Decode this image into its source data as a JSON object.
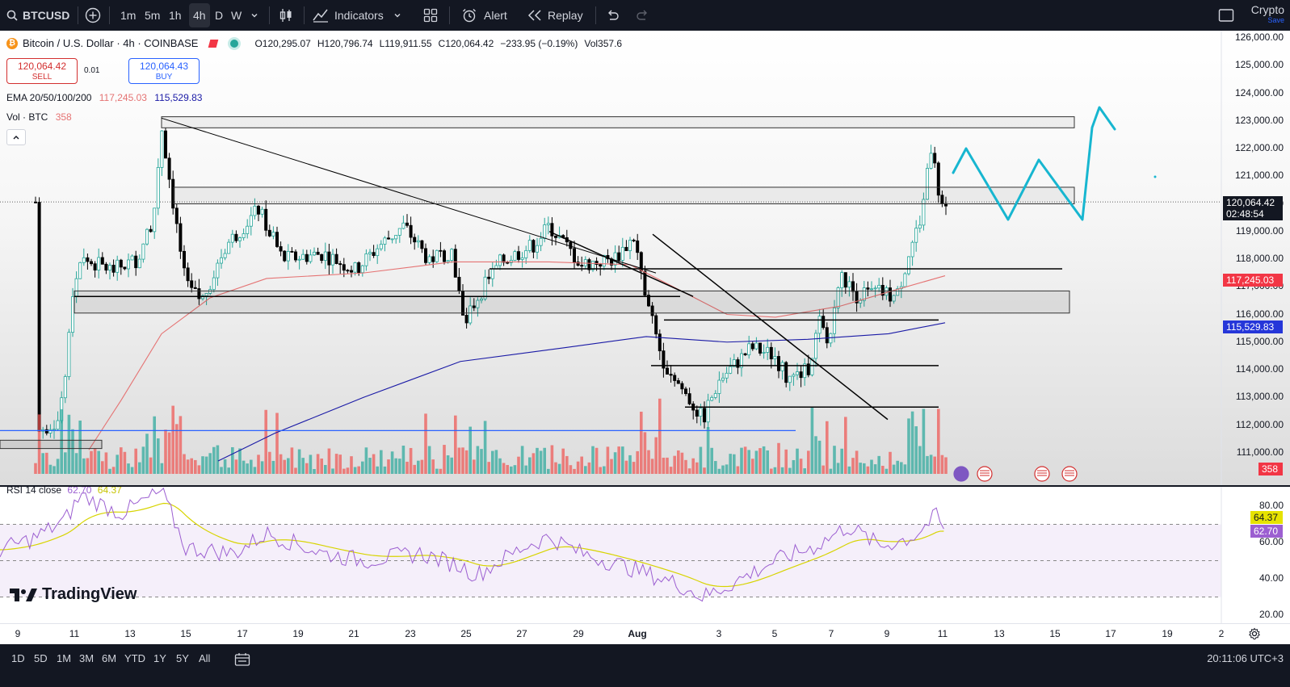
{
  "toolbar": {
    "symbol": "BTCUSD",
    "intervals": [
      "1m",
      "5m",
      "1h",
      "4h",
      "D",
      "W"
    ],
    "active_interval": "4h",
    "indicators_label": "Indicators",
    "alert_label": "Alert",
    "replay_label": "Replay",
    "account_label": "Crypto",
    "account_sub": "Save"
  },
  "legend": {
    "title": "Bitcoin / U.S. Dollar · 4h · COINBASE",
    "open": "O120,295.07",
    "high": "H120,796.74",
    "low": "L119,911.55",
    "close": "C120,064.42",
    "change": "−233.95 (−0.19%)",
    "volume": "Vol357.6"
  },
  "trade": {
    "sell_price": "120,064.42",
    "sell_label": "SELL",
    "spread": "0.01",
    "buy_price": "120,064.43",
    "buy_label": "BUY"
  },
  "ema": {
    "label": "EMA 20/50/100/200",
    "v1": "117,245.03",
    "v2": "115,529.83",
    "color1": "#e57373",
    "color2": "#1a1aa6"
  },
  "vol": {
    "label": "Vol · BTC",
    "value": "358"
  },
  "price_axis": {
    "labels": [
      "126,000.00",
      "125,000.00",
      "124,000.00",
      "123,000.00",
      "122,000.00",
      "121,000.00",
      "120,000.00",
      "119,000.00",
      "118,000.00",
      "117,000.00",
      "116,000.00",
      "115,000.00",
      "114,000.00",
      "113,000.00",
      "112,000.00",
      "111,000.00"
    ],
    "current_price": "120,064.42",
    "countdown": "02:48:54",
    "ema1_tag": "117,245.03",
    "ema2_tag": "115,529.83",
    "vol_tag": "358"
  },
  "rsi": {
    "label": "RSI 14 close",
    "value": "62.70",
    "ma_value": "64.37",
    "axis_labels": [
      "80.00",
      "60.00",
      "40.00",
      "20.00"
    ],
    "line_color": "#9c5fd1",
    "ma_color": "#d7d400"
  },
  "time_axis": {
    "labels": [
      "9",
      "11",
      "13",
      "15",
      "17",
      "19",
      "21",
      "23",
      "25",
      "27",
      "29",
      "Aug",
      "3",
      "5",
      "7",
      "9",
      "11",
      "13",
      "15",
      "17",
      "19",
      "2"
    ]
  },
  "bottom": {
    "ranges": [
      "1D",
      "5D",
      "1M",
      "3M",
      "6M",
      "YTD",
      "1Y",
      "5Y",
      "All"
    ],
    "clock": "20:11:06 UTC+3"
  },
  "watermark": "TradingView",
  "colors": {
    "bull": "#26a69a",
    "bear": "#000000",
    "vol_bull": "#26a69a",
    "vol_bear": "#ef5350",
    "drawing_cyan": "#17b6d0",
    "price_tag": "#131722",
    "ema1_tag_bg": "#f23645",
    "ema2_tag_bg": "#2536d9"
  }
}
